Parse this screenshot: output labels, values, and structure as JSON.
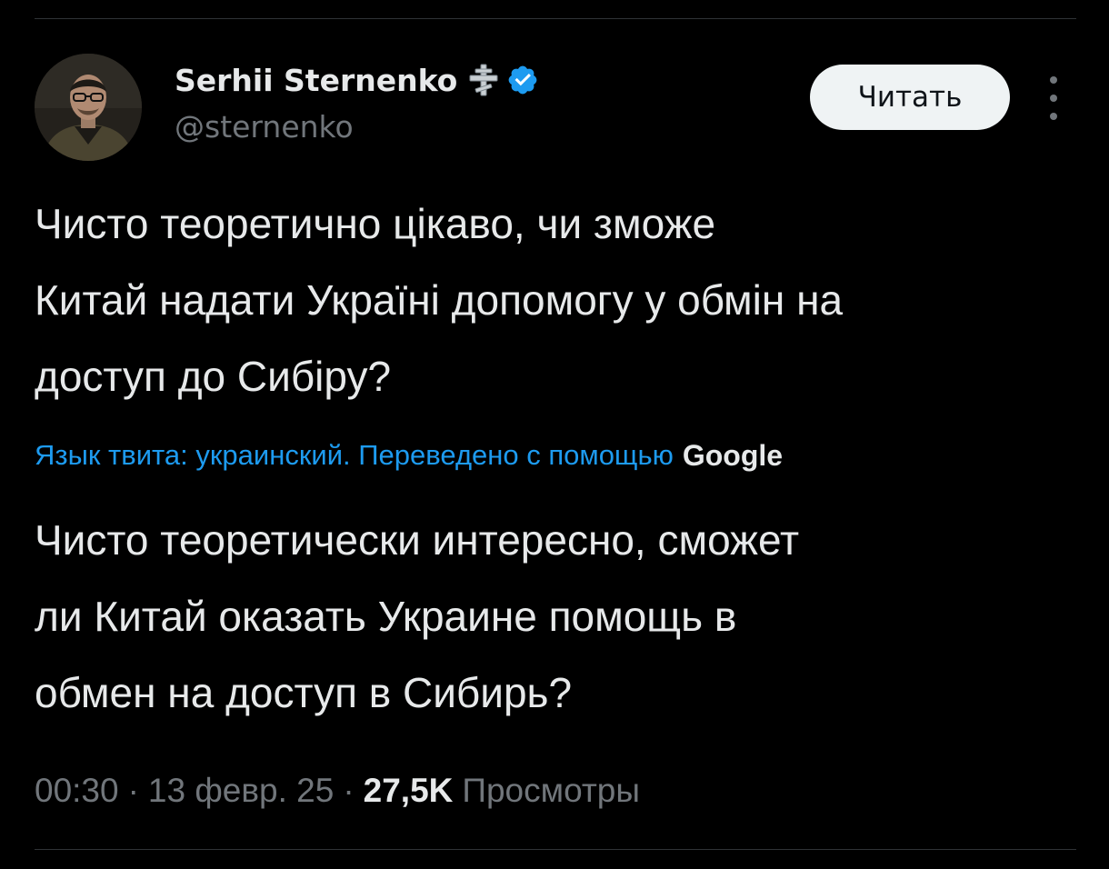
{
  "author": {
    "display_name": "Serhii Sternenko",
    "handle": "@sternenko"
  },
  "follow_button": {
    "label": "Читать"
  },
  "tweet": {
    "original_lines": [
      "Чисто теоретично цікаво, чи зможе",
      "Китай надати Україні допомогу у обмін на",
      "доступ до Сибіру?"
    ],
    "translation_note": "Язык твита: украинский. Переведено с помощью",
    "translator_logo": "Google",
    "translated_lines": [
      "Чисто теоретически интересно, сможет",
      "ли Китай оказать Украине помощь в",
      "обмен на доступ в Сибирь?"
    ]
  },
  "meta": {
    "time": "00:30",
    "separator": "·",
    "date": "13 февр. 25",
    "views_count": "27,5K",
    "views_label": "Просмотры"
  },
  "icons": {
    "cross": "orthodox-cross-icon",
    "verified": "verified-badge-icon",
    "more": "more-vertical-icon"
  },
  "colors": {
    "background": "#000000",
    "text_primary": "#e7e9ea",
    "text_secondary": "#71767b",
    "link_blue": "#1d9bf0",
    "verified_blue": "#1d9bf0",
    "button_bg": "#eff3f4",
    "button_text": "#0f1419",
    "divider": "#2f3336"
  }
}
